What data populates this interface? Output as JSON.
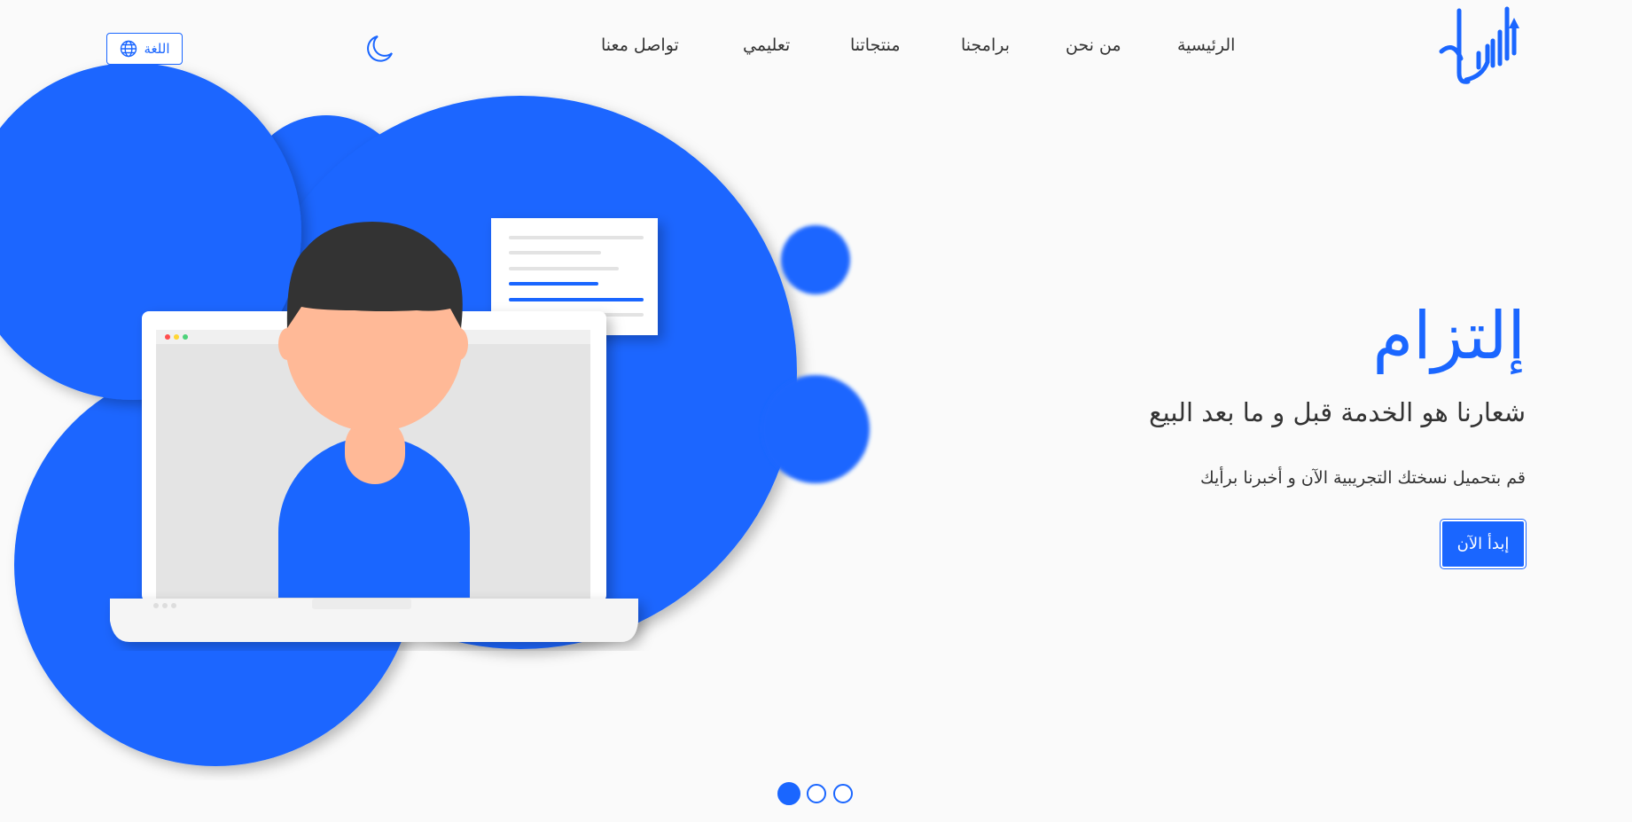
{
  "nav": {
    "items": [
      {
        "label": "الرئيسية"
      },
      {
        "label": "من نحن"
      },
      {
        "label": "برامجنا"
      },
      {
        "label": "منتجاتنا"
      },
      {
        "label": "تعليمي"
      },
      {
        "label": "تواصل معنا"
      }
    ],
    "theme_toggle_icon": "moon-icon",
    "language_label": "اللغة",
    "language_icon": "globe-icon"
  },
  "hero": {
    "title": "إلتزام",
    "subtitle": "شعارنا هو الخدمة قبل و ما بعد البيع",
    "description": "قم بتحميل نسختك التجريبية الآن و أخبرنا برأيك",
    "cta_label": "إبدأ الآن"
  },
  "slider": {
    "count": 3,
    "active_index": 0
  },
  "colors": {
    "accent": "#1a66ff",
    "background": "#fafafa",
    "text": "#333333",
    "skin": "#ffb997",
    "hair": "#333333"
  }
}
